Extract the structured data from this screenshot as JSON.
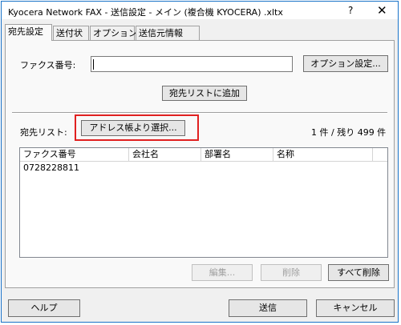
{
  "window": {
    "title": "Kyocera Network FAX - 送信設定 - メイン (複合機 KYOCERA) .xltx",
    "help_glyph": "?",
    "close_glyph": "✕"
  },
  "tabs": [
    {
      "label": "宛先設定",
      "active": true
    },
    {
      "label": "送付状",
      "active": false
    },
    {
      "label": "オプション",
      "active": false
    },
    {
      "label": "送信元情報",
      "active": false
    }
  ],
  "destination": {
    "fax_label": "ファクス番号:",
    "fax_value": "",
    "options_button": "オプション設定...",
    "add_button": "宛先リストに追加",
    "list_label": "宛先リスト:",
    "addressbook_button": "アドレス帳より選択...",
    "count_text": "1 件 / 残り 499 件",
    "columns": [
      "ファクス番号",
      "会社名",
      "部署名",
      "名称"
    ],
    "rows": [
      [
        "0728228811",
        "",
        "",
        ""
      ]
    ],
    "edit_button": "編集...",
    "delete_button": "削除",
    "delete_all_button": "すべて削除"
  },
  "footer": {
    "help_button": "ヘルプ",
    "send_button": "送信",
    "cancel_button": "キャンセル"
  },
  "colors": {
    "highlight_box": "#e02020",
    "window_border": "#1a73c8"
  }
}
